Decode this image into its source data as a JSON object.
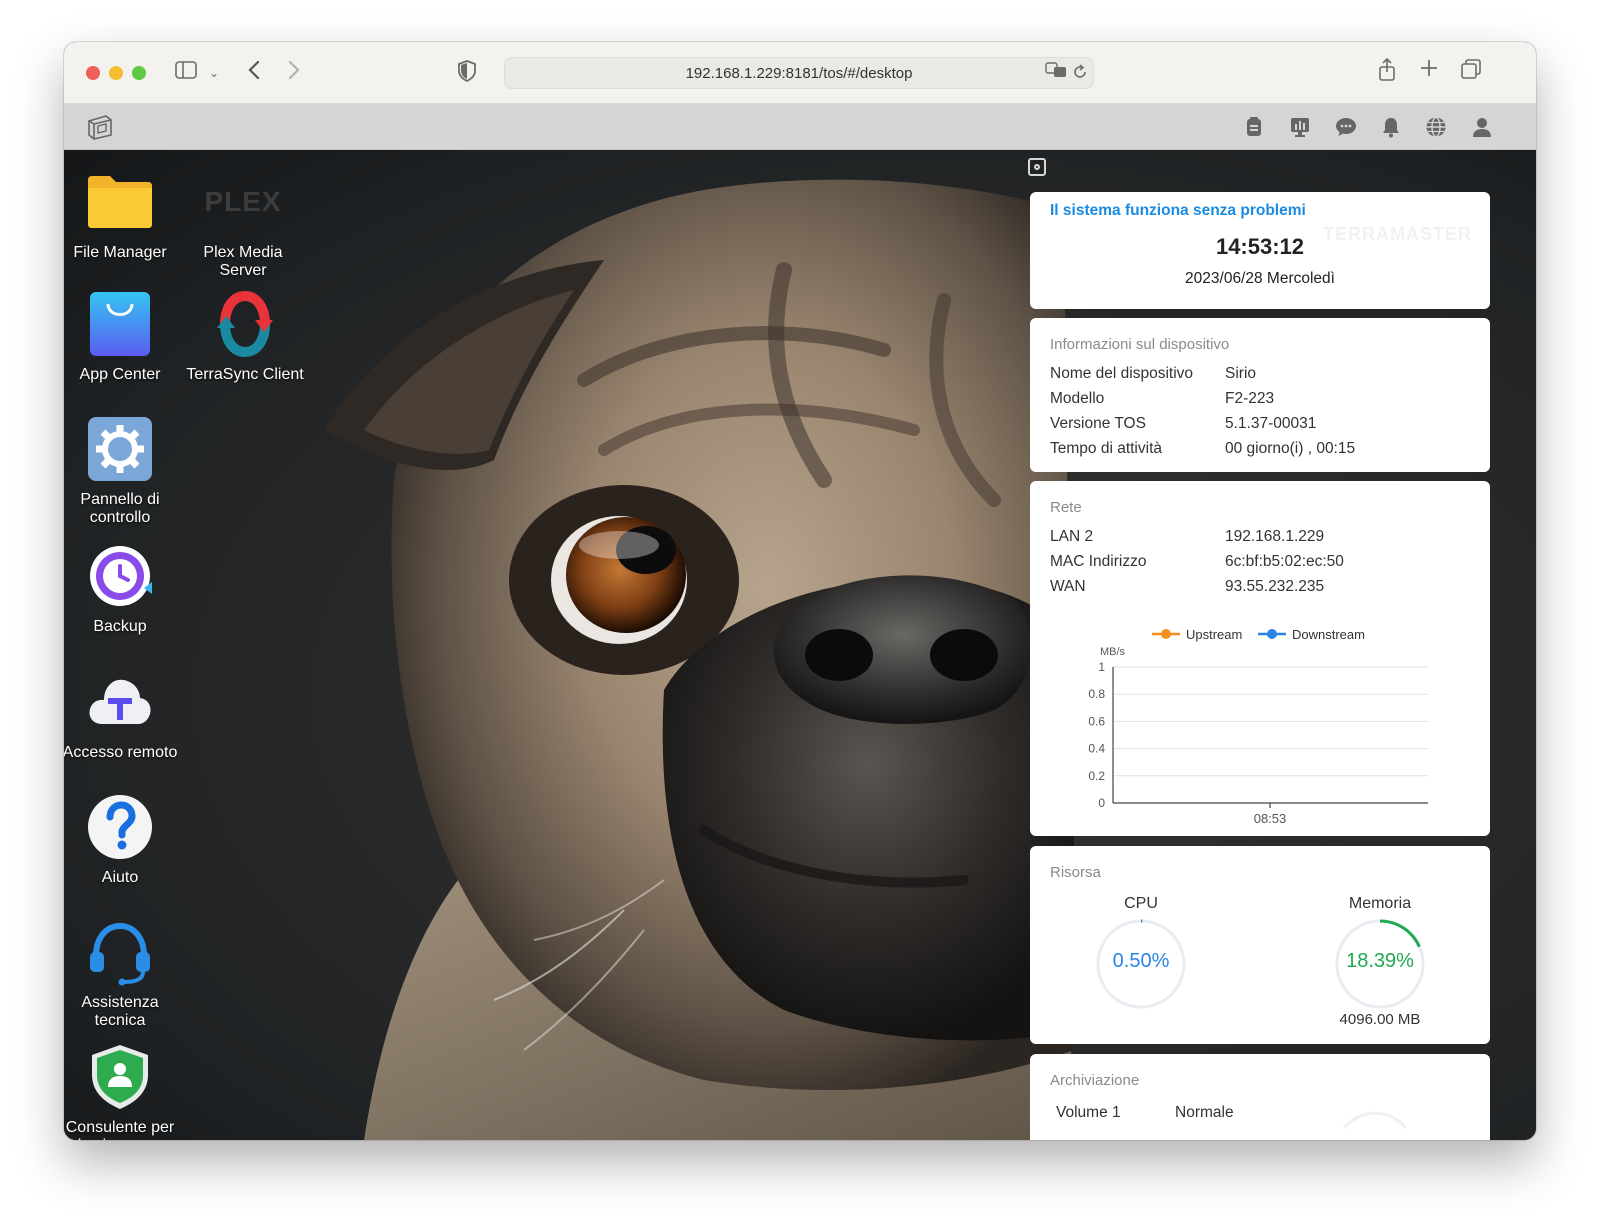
{
  "browser": {
    "url": "192.168.1.229:8181/tos/#/desktop"
  },
  "apps": [
    {
      "name": "File Manager"
    },
    {
      "name": "Plex Media Server"
    },
    {
      "name": "App Center"
    },
    {
      "name": "TerraSync Client"
    },
    {
      "name": "Pannello di controllo"
    },
    {
      "name": "Backup"
    },
    {
      "name": "Accesso remoto"
    },
    {
      "name": "Aiuto"
    },
    {
      "name": "Assistenza tecnica"
    },
    {
      "name": "Consulente per la sicurezza"
    }
  ],
  "plex_logo_text": "PLEX",
  "status": {
    "message": "Il sistema funziona senza problemi",
    "time": "14:53:12",
    "date": "2023/06/28 Mercoledì",
    "watermark": "TERRAMASTER"
  },
  "device": {
    "title": "Informazioni sul dispositivo",
    "rows": [
      {
        "key": "Nome del dispositivo",
        "value": "Sirio"
      },
      {
        "key": "Modello",
        "value": "F2-223"
      },
      {
        "key": "Versione TOS",
        "value": "5.1.37-00031"
      },
      {
        "key": "Tempo di attività",
        "value": "00 giorno(i) , 00:15"
      }
    ]
  },
  "network": {
    "title": "Rete",
    "rows": [
      {
        "key": "LAN 2",
        "value": "192.168.1.229"
      },
      {
        "key": "MAC Indirizzo",
        "value": "6c:bf:b5:02:ec:50"
      },
      {
        "key": "WAN",
        "value": "93.55.232.235"
      }
    ]
  },
  "chart_data": {
    "type": "line",
    "ylabel": "MB/s",
    "ylim": [
      0,
      1
    ],
    "yticks": [
      "0",
      "0.2",
      "0.4",
      "0.6",
      "0.8",
      "1"
    ],
    "categories": [
      "08:53"
    ],
    "series": [
      {
        "name": "Upstream",
        "color": "#f5901e",
        "values": []
      },
      {
        "name": "Downstream",
        "color": "#2a85e6",
        "values": []
      }
    ],
    "grid": true,
    "legend": "top"
  },
  "resource": {
    "title": "Risorsa",
    "cpu": {
      "label": "CPU",
      "value": "0.50%",
      "fraction": 0.005,
      "color": "#2a85e6"
    },
    "memory": {
      "label": "Memoria",
      "value": "18.39%",
      "fraction": 0.1839,
      "total": "4096.00 MB",
      "color": "#1faa52"
    }
  },
  "storage": {
    "title": "Archiviazione",
    "rows": [
      {
        "key": "Volume 1",
        "value": "Normale"
      }
    ]
  },
  "colors": {
    "accent": "#1a8be0",
    "folder": "#f7bf2f"
  }
}
